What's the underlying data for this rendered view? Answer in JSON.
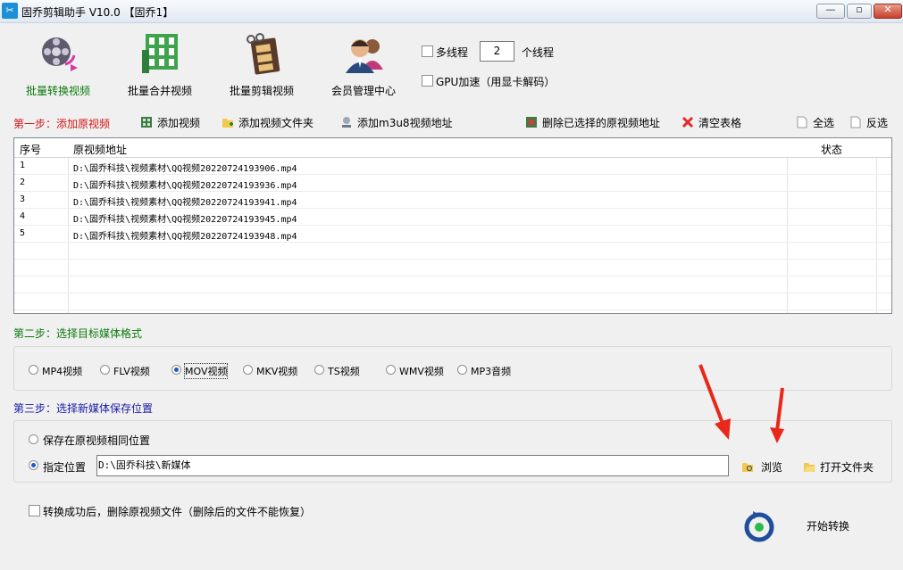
{
  "window": {
    "title": "固乔剪辑助手 V10.0  【固乔1】",
    "icon_text": "✂",
    "controls": {
      "minimize": "—",
      "maximize": "▫",
      "close": "✕"
    }
  },
  "toolbar": {
    "batch_convert": "批量转换视频",
    "batch_merge": "批量合并视频",
    "batch_edit": "批量剪辑视频",
    "member_center": "会员管理中心",
    "multithread_label": "多线程",
    "thread_count": "2",
    "thread_unit": "个线程",
    "gpu_label": "GPU加速（用显卡解码）"
  },
  "step1": {
    "title": "第一步：添加原视频",
    "add_video": "添加视频",
    "add_folder": "添加视频文件夹",
    "add_m3u8": "添加m3u8视频地址",
    "delete_selected": "删除已选择的原视频地址",
    "clear_table": "清空表格",
    "select_all": "全选",
    "invert_select": "反选"
  },
  "table": {
    "columns": [
      "序号",
      "原视频地址",
      "状态"
    ],
    "rows": [
      {
        "index": "1",
        "path": "D:\\固乔科技\\视频素材\\QQ视频20220724193906.mp4",
        "status": ""
      },
      {
        "index": "2",
        "path": "D:\\固乔科技\\视频素材\\QQ视频20220724193936.mp4",
        "status": ""
      },
      {
        "index": "3",
        "path": "D:\\固乔科技\\视频素材\\QQ视频20220724193941.mp4",
        "status": ""
      },
      {
        "index": "4",
        "path": "D:\\固乔科技\\视频素材\\QQ视频20220724193945.mp4",
        "status": ""
      },
      {
        "index": "5",
        "path": "D:\\固乔科技\\视频素材\\QQ视频20220724193948.mp4",
        "status": ""
      }
    ]
  },
  "step2": {
    "title": "第二步：选择目标媒体格式",
    "formats": [
      "MP4视频",
      "FLV视频",
      "MOV视频",
      "MKV视频",
      "TS视频",
      "WMV视频",
      "MP3音频"
    ],
    "selected": "MOV视频"
  },
  "step3": {
    "title": "第三步：选择新媒体保存位置",
    "same_location": "保存在原视频相同位置",
    "custom_location": "指定位置",
    "path_value": "D:\\固乔科技\\新媒体",
    "browse": "浏览",
    "open_folder": "打开文件夹"
  },
  "footer": {
    "delete_after_convert": "转换成功后，删除原视频文件（删除后的文件不能恢复）",
    "start": "开始转换"
  },
  "colors": {
    "step1": "#d01616",
    "step2": "#0b7a0b",
    "step3": "#1a1aa5",
    "annotation_arrow": "#e8281b"
  }
}
